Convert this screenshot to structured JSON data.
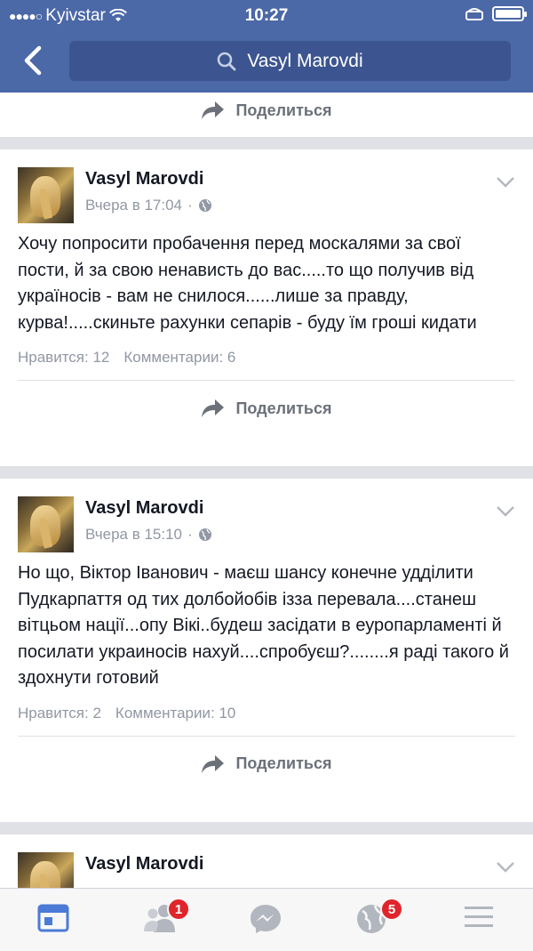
{
  "status_bar": {
    "carrier": "Kyivstar",
    "time": "10:27"
  },
  "search": {
    "query": "Vasyl Marovdi"
  },
  "share_label": "Поделиться",
  "posts": [
    {
      "author": "Vasyl Marovdi",
      "time": "Вчера в 17:04",
      "separator": "·",
      "text": "Хочу попросити пробачення перед москалями за свої пости, й за свою ненависть до вас.....то що получив від україносів - вам не снилося......лише за правду, курва!.....скиньте рахунки сепарів - буду їм гроші кидати",
      "likes": "Нравится: 12",
      "comments": "Комментарии: 6"
    },
    {
      "author": "Vasyl Marovdi",
      "time": "Вчера в 15:10",
      "separator": "·",
      "text": "Но що, Віктор Іванович - маєш шансу конечне удділити Пудкарпаття од тих долбойобів ізза перевала....станеш вітцьом нації...опу Вікі..будеш засідати в еуропарламенті й посилати украиносів нахуй....спробуєш?........я раді такого й здохнути готовий",
      "likes": "Нравится: 2",
      "comments": "Комментарии: 10"
    },
    {
      "author": "Vasyl Marovdi"
    }
  ],
  "tabbar": {
    "friends_badge": "1",
    "notifications_badge": "5"
  },
  "colors": {
    "header": "#4b68a7",
    "accent": "#4b68a7",
    "badge": "#e0252a"
  }
}
